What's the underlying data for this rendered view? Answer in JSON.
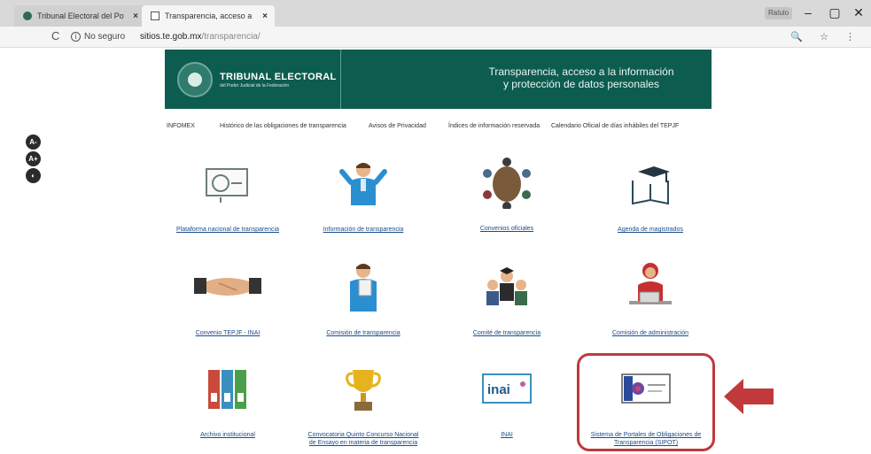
{
  "browser": {
    "tabs": [
      {
        "title": "Tribunal Electoral del Po",
        "close": "×"
      },
      {
        "title": "Transparencia, acceso a",
        "close": "×"
      }
    ],
    "profile_label": "Ratulo",
    "window_controls": {
      "minimize": "–",
      "maximize": "▢",
      "close": "✕"
    },
    "security_label": "No seguro",
    "url_host": "sitios.te.gob.mx",
    "url_path": "/transparencia/",
    "reload_glyph": "C",
    "info_glyph": "i",
    "addr_icons": "🔍 ☆ ⋮"
  },
  "banner": {
    "org_name": "TRIBUNAL ELECTORAL",
    "org_subtitle": "del Poder Judicial de la Federación",
    "tagline_line1": "Transparencia, acceso a la información",
    "tagline_line2": "y protección de datos personales"
  },
  "nav": [
    "INFOMEX",
    "Histórico de las obligaciones de transparencia",
    "Avisos de Privacidad",
    "Índices de información reservada",
    "Calendario Oficial de días inhábiles del TEPJF"
  ],
  "accessibility": {
    "decrease": "A-",
    "increase": "A+",
    "contrast": "◐"
  },
  "cards": [
    {
      "label": "Plataforma nacional de transparencia",
      "icon": "monitor-icon"
    },
    {
      "label": "Información de transparencia",
      "icon": "person-presenting-icon"
    },
    {
      "label": "Convenios oficiales",
      "icon": "meeting-table-icon"
    },
    {
      "label": "Agenda de magistrados",
      "icon": "graduation-book-icon"
    },
    {
      "label": "Convenio TEPJF - INAI",
      "icon": "handshake-icon"
    },
    {
      "label": "Comisión de transparencia",
      "icon": "person-document-icon"
    },
    {
      "label": "Comité de transparencia",
      "icon": "committee-icon"
    },
    {
      "label": "Comisión de administración",
      "icon": "person-laptop-icon"
    },
    {
      "label": "Archivo institucional",
      "icon": "binders-icon"
    },
    {
      "label_line1": "Convocatoria Quinto Concurso Nacional",
      "label_line2": "de Ensayo en materia de transparencia",
      "icon": "trophy-icon"
    },
    {
      "label": "INAI",
      "icon": "inai-logo-icon",
      "logo_text": "inai"
    },
    {
      "label_line1": "Sistema de Portales de Obligaciones de",
      "label_line2": "Transparencia (SIPOT)",
      "icon": "sipot-logo-icon"
    }
  ],
  "colors": {
    "banner": "#0d5c50",
    "highlight": "#c0393b",
    "link": "#1a4c8a"
  }
}
